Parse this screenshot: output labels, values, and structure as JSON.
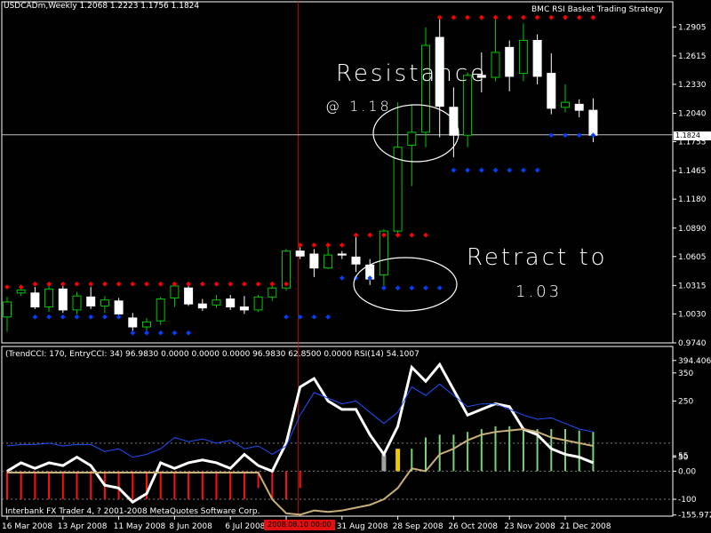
{
  "header": {
    "symbol_info": "USDCADm,Weekly  1.2068 1.2223 1.1756 1.1824",
    "strategy": "BMC RSI Basket Trading Strategy",
    "indicator_info": "(TrendCCI: 170, EntryCCI: 34)  96.9830 0.0000 0.0000 0.0000 96.9830 62.8500 0.0000  RSI(14) 54.1007",
    "copyright": "Interbank FX Trader 4, ? 2001-2008 MetaQuotes Software Corp."
  },
  "current_price_label": "1.1824",
  "crosshair_time": "2008.08.10 00:00",
  "annotations": {
    "resistance_word": "Resistance",
    "resistance_level": "@ 1.18",
    "retract_word": "Retract to",
    "retract_level": "1.03"
  },
  "colors": {
    "bull_candle": "#00c800",
    "bear_candle": "#ffffff",
    "resistance_dot": "#ff0000",
    "support_dot": "#0040ff",
    "cci_line": "#ffffff",
    "rsi_line": "#2050ff",
    "entry_line": "#c8b078",
    "hist_negative": "#ff1010",
    "hist_positive": "#78d278",
    "crosshair": "#c81010"
  },
  "chart_data": [
    {
      "type": "candlestick",
      "price_axis_ticks": [
        "1.2905",
        "1.2615",
        "1.2330",
        "1.2040",
        "1.1755",
        "1.1465",
        "1.1180",
        "1.0890",
        "1.0605",
        "1.0315",
        "1.0030",
        "0.9740"
      ],
      "ylim": [
        0.974,
        1.305
      ],
      "time_axis_labels": [
        "16 Mar 2008",
        "13 Apr 2008",
        "11 May 2008",
        "8 Jun 2008",
        "6 Jul 2008",
        "3 Aug 2008",
        "31 Aug 2008",
        "28 Sep 2008",
        "26 Oct 2008",
        "23 Nov 2008",
        "21 Dec 2008"
      ],
      "time_axis_label_bars": [
        0,
        4,
        8,
        12,
        16,
        20,
        24,
        28,
        32,
        36,
        40
      ],
      "candles": [
        {
          "o": 1.0,
          "h": 1.02,
          "l": 0.985,
          "c": 1.015
        },
        {
          "o": 1.024,
          "h": 1.029,
          "l": 1.021,
          "c": 1.027
        },
        {
          "o": 1.024,
          "h": 1.03,
          "l": 1.008,
          "c": 1.01
        },
        {
          "o": 1.01,
          "h": 1.032,
          "l": 1.005,
          "c": 1.028
        },
        {
          "o": 1.028,
          "h": 1.031,
          "l": 1.004,
          "c": 1.007
        },
        {
          "o": 1.007,
          "h": 1.025,
          "l": 1.003,
          "c": 1.021
        },
        {
          "o": 1.02,
          "h": 1.03,
          "l": 1.008,
          "c": 1.011
        },
        {
          "o": 1.011,
          "h": 1.021,
          "l": 1.004,
          "c": 1.017
        },
        {
          "o": 1.016,
          "h": 1.019,
          "l": 1.001,
          "c": 1.003
        },
        {
          "o": 0.999,
          "h": 1.004,
          "l": 0.985,
          "c": 0.99
        },
        {
          "o": 0.99,
          "h": 0.999,
          "l": 0.982,
          "c": 0.995
        },
        {
          "o": 0.996,
          "h": 1.02,
          "l": 0.992,
          "c": 1.018
        },
        {
          "o": 1.019,
          "h": 1.034,
          "l": 1.01,
          "c": 1.031
        },
        {
          "o": 1.029,
          "h": 1.033,
          "l": 1.011,
          "c": 1.013
        },
        {
          "o": 1.013,
          "h": 1.018,
          "l": 1.006,
          "c": 1.009
        },
        {
          "o": 1.012,
          "h": 1.022,
          "l": 1.009,
          "c": 1.017
        },
        {
          "o": 1.018,
          "h": 1.022,
          "l": 1.007,
          "c": 1.01
        },
        {
          "o": 1.01,
          "h": 1.021,
          "l": 1.003,
          "c": 1.007
        },
        {
          "o": 1.007,
          "h": 1.022,
          "l": 1.005,
          "c": 1.02
        },
        {
          "o": 1.02,
          "h": 1.034,
          "l": 1.016,
          "c": 1.029
        },
        {
          "o": 1.029,
          "h": 1.068,
          "l": 1.026,
          "c": 1.066
        },
        {
          "o": 1.066,
          "h": 1.07,
          "l": 1.058,
          "c": 1.061
        },
        {
          "o": 1.063,
          "h": 1.068,
          "l": 1.04,
          "c": 1.049
        },
        {
          "o": 1.049,
          "h": 1.072,
          "l": 1.048,
          "c": 1.062
        },
        {
          "o": 1.063,
          "h": 1.066,
          "l": 1.058,
          "c": 1.062
        },
        {
          "o": 1.06,
          "h": 1.08,
          "l": 1.045,
          "c": 1.053
        },
        {
          "o": 1.052,
          "h": 1.058,
          "l": 1.032,
          "c": 1.038
        },
        {
          "o": 1.042,
          "h": 1.088,
          "l": 1.03,
          "c": 1.086
        },
        {
          "o": 1.086,
          "h": 1.215,
          "l": 1.08,
          "c": 1.17
        },
        {
          "o": 1.172,
          "h": 1.212,
          "l": 1.131,
          "c": 1.185
        },
        {
          "o": 1.185,
          "h": 1.29,
          "l": 1.17,
          "c": 1.272
        },
        {
          "o": 1.28,
          "h": 1.3,
          "l": 1.18,
          "c": 1.211
        },
        {
          "o": 1.21,
          "h": 1.23,
          "l": 1.16,
          "c": 1.182
        },
        {
          "o": 1.182,
          "h": 1.245,
          "l": 1.17,
          "c": 1.242
        },
        {
          "o": 1.242,
          "h": 1.265,
          "l": 1.225,
          "c": 1.24
        },
        {
          "o": 1.24,
          "h": 1.3,
          "l": 1.236,
          "c": 1.265
        },
        {
          "o": 1.27,
          "h": 1.277,
          "l": 1.226,
          "c": 1.241
        },
        {
          "o": 1.244,
          "h": 1.294,
          "l": 1.236,
          "c": 1.277
        },
        {
          "o": 1.277,
          "h": 1.283,
          "l": 1.233,
          "c": 1.241
        },
        {
          "o": 1.244,
          "h": 1.264,
          "l": 1.203,
          "c": 1.209
        },
        {
          "o": 1.21,
          "h": 1.233,
          "l": 1.205,
          "c": 1.215
        },
        {
          "o": 1.213,
          "h": 1.218,
          "l": 1.2,
          "c": 1.207
        },
        {
          "o": 1.207,
          "h": 1.219,
          "l": 1.175,
          "c": 1.182
        }
      ],
      "resistance_dots": [
        {
          "bar": 0,
          "y": 1.03
        },
        {
          "bar": 1,
          "y": 1.03
        },
        {
          "bar": 2,
          "y": 1.033
        },
        {
          "bar": 3,
          "y": 1.033
        },
        {
          "bar": 4,
          "y": 1.033
        },
        {
          "bar": 5,
          "y": 1.033
        },
        {
          "bar": 6,
          "y": 1.033
        },
        {
          "bar": 7,
          "y": 1.033
        },
        {
          "bar": 8,
          "y": 1.033
        },
        {
          "bar": 9,
          "y": 1.033
        },
        {
          "bar": 10,
          "y": 1.033
        },
        {
          "bar": 11,
          "y": 1.033
        },
        {
          "bar": 12,
          "y": 1.033
        },
        {
          "bar": 13,
          "y": 1.033
        },
        {
          "bar": 14,
          "y": 1.033
        },
        {
          "bar": 15,
          "y": 1.033
        },
        {
          "bar": 16,
          "y": 1.033
        },
        {
          "bar": 17,
          "y": 1.033
        },
        {
          "bar": 18,
          "y": 1.033
        },
        {
          "bar": 19,
          "y": 1.033
        },
        {
          "bar": 20,
          "y": 1.033
        },
        {
          "bar": 21,
          "y": 1.072
        },
        {
          "bar": 22,
          "y": 1.072
        },
        {
          "bar": 23,
          "y": 1.072
        },
        {
          "bar": 24,
          "y": 1.072
        },
        {
          "bar": 25,
          "y": 1.082
        },
        {
          "bar": 26,
          "y": 1.082
        },
        {
          "bar": 27,
          "y": 1.082
        },
        {
          "bar": 28,
          "y": 1.082
        },
        {
          "bar": 29,
          "y": 1.082
        },
        {
          "bar": 30,
          "y": 1.082
        },
        {
          "bar": 31,
          "y": 1.3
        },
        {
          "bar": 32,
          "y": 1.3
        },
        {
          "bar": 33,
          "y": 1.3
        },
        {
          "bar": 34,
          "y": 1.3
        },
        {
          "bar": 35,
          "y": 1.3
        },
        {
          "bar": 36,
          "y": 1.3
        },
        {
          "bar": 37,
          "y": 1.3
        },
        {
          "bar": 38,
          "y": 1.3
        },
        {
          "bar": 39,
          "y": 1.3
        },
        {
          "bar": 40,
          "y": 1.3
        },
        {
          "bar": 41,
          "y": 1.3
        },
        {
          "bar": 42,
          "y": 1.3
        }
      ],
      "support_dots": [
        {
          "bar": 2,
          "y": 1.0
        },
        {
          "bar": 3,
          "y": 1.0
        },
        {
          "bar": 4,
          "y": 1.0
        },
        {
          "bar": 5,
          "y": 1.0
        },
        {
          "bar": 6,
          "y": 1.0
        },
        {
          "bar": 7,
          "y": 1.0
        },
        {
          "bar": 8,
          "y": 1.0
        },
        {
          "bar": 9,
          "y": 0.984
        },
        {
          "bar": 10,
          "y": 0.984
        },
        {
          "bar": 11,
          "y": 0.984
        },
        {
          "bar": 12,
          "y": 0.984
        },
        {
          "bar": 13,
          "y": 0.984
        },
        {
          "bar": 20,
          "y": 1.0
        },
        {
          "bar": 21,
          "y": 1.0
        },
        {
          "bar": 22,
          "y": 1.0
        },
        {
          "bar": 23,
          "y": 1.0
        },
        {
          "bar": 24,
          "y": 1.039
        },
        {
          "bar": 25,
          "y": 1.039
        },
        {
          "bar": 26,
          "y": 1.039
        },
        {
          "bar": 27,
          "y": 1.029
        },
        {
          "bar": 28,
          "y": 1.029
        },
        {
          "bar": 29,
          "y": 1.029
        },
        {
          "bar": 30,
          "y": 1.029
        },
        {
          "bar": 31,
          "y": 1.029
        },
        {
          "bar": 32,
          "y": 1.147
        },
        {
          "bar": 33,
          "y": 1.147
        },
        {
          "bar": 34,
          "y": 1.147
        },
        {
          "bar": 35,
          "y": 1.147
        },
        {
          "bar": 36,
          "y": 1.147
        },
        {
          "bar": 37,
          "y": 1.147
        },
        {
          "bar": 38,
          "y": 1.147
        },
        {
          "bar": 39,
          "y": 1.182
        },
        {
          "bar": 40,
          "y": 1.182
        },
        {
          "bar": 41,
          "y": 1.182
        },
        {
          "bar": 42,
          "y": 1.182
        }
      ]
    },
    {
      "type": "line",
      "value_axis_ticks": [
        "394.4069",
        "350",
        "250",
        "55",
        "50",
        "0.00",
        "-100",
        "-155.972"
      ],
      "ylim": [
        -160,
        400
      ],
      "series": [
        {
          "values": [
            0,
            30,
            10,
            30,
            20,
            50,
            20,
            -50,
            -60,
            -110,
            -80,
            30,
            10,
            30,
            40,
            30,
            10,
            60,
            20,
            0,
            100,
            300,
            330,
            250,
            220,
            220,
            130,
            60,
            160,
            370,
            320,
            380,
            290,
            200,
            220,
            240,
            230,
            150,
            130,
            80,
            60,
            50,
            30
          ]
        },
        {
          "values": [
            90,
            95,
            95,
            100,
            90,
            95,
            95,
            70,
            80,
            50,
            60,
            80,
            120,
            105,
            115,
            100,
            110,
            80,
            90,
            60,
            90,
            200,
            280,
            260,
            240,
            250,
            210,
            170,
            210,
            300,
            270,
            310,
            270,
            230,
            240,
            240,
            220,
            200,
            185,
            190,
            170,
            150,
            140
          ]
        },
        {
          "values": [
            -5,
            -5,
            -5,
            -5,
            -5,
            -5,
            -5,
            -5,
            -5,
            -5,
            -5,
            -5,
            -5,
            -5,
            -5,
            -5,
            -5,
            -5,
            -5,
            -100,
            -150,
            -155,
            -140,
            -145,
            -140,
            -130,
            -120,
            -100,
            -60,
            10,
            0,
            60,
            80,
            110,
            130,
            140,
            145,
            150,
            140,
            120,
            110,
            100,
            90
          ]
        }
      ],
      "histogram": [
        {
          "bar": 0,
          "v": -100
        },
        {
          "bar": 1,
          "v": -100
        },
        {
          "bar": 2,
          "v": -100
        },
        {
          "bar": 3,
          "v": -100
        },
        {
          "bar": 4,
          "v": -100
        },
        {
          "bar": 5,
          "v": -100
        },
        {
          "bar": 6,
          "v": -100
        },
        {
          "bar": 7,
          "v": -100
        },
        {
          "bar": 8,
          "v": -100
        },
        {
          "bar": 9,
          "v": -100
        },
        {
          "bar": 10,
          "v": -100
        },
        {
          "bar": 11,
          "v": -100
        },
        {
          "bar": 12,
          "v": -100
        },
        {
          "bar": 13,
          "v": -100
        },
        {
          "bar": 14,
          "v": -100
        },
        {
          "bar": 15,
          "v": -100
        },
        {
          "bar": 16,
          "v": -100
        },
        {
          "bar": 17,
          "v": -100
        },
        {
          "bar": 18,
          "v": -60
        },
        {
          "bar": 19,
          "v": -100
        },
        {
          "bar": 20,
          "v": -100
        },
        {
          "bar": 21,
          "v": -60
        },
        {
          "bar": 28,
          "v": 60
        },
        {
          "bar": 29,
          "v": 80
        },
        {
          "bar": 30,
          "v": 120
        },
        {
          "bar": 31,
          "v": 130
        },
        {
          "bar": 32,
          "v": 130
        },
        {
          "bar": 33,
          "v": 140
        },
        {
          "bar": 34,
          "v": 150
        },
        {
          "bar": 35,
          "v": 160
        },
        {
          "bar": 36,
          "v": 160
        },
        {
          "bar": 37,
          "v": 155
        },
        {
          "bar": 38,
          "v": 150
        },
        {
          "bar": 39,
          "v": 150
        },
        {
          "bar": 40,
          "v": 150
        },
        {
          "bar": 41,
          "v": 145
        },
        {
          "bar": 42,
          "v": 140
        }
      ],
      "signal_bars": [
        {
          "bar": 27,
          "v": 60,
          "color": "#a0a0a0"
        },
        {
          "bar": 28,
          "v": 80,
          "color": "#f0c800"
        }
      ]
    }
  ]
}
